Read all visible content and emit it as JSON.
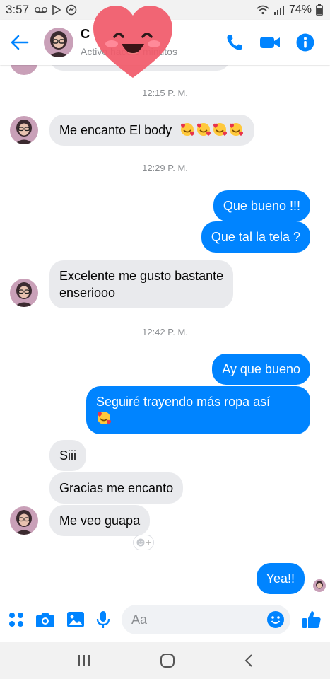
{
  "status_bar": {
    "time": "3:57",
    "battery": "74%"
  },
  "header": {
    "contact_name": "C",
    "active_status": "Activo hace 9 minutos"
  },
  "messages": [
    {
      "type": "time",
      "text": "12:15 P. M."
    },
    {
      "type": "in",
      "text": "Me encanto El body",
      "emoji_count": 4
    },
    {
      "type": "time",
      "text": "12:29 P. M."
    },
    {
      "type": "out",
      "text": "Que bueno !!!"
    },
    {
      "type": "out",
      "text": "Que tal la tela ?"
    },
    {
      "type": "in",
      "lines": [
        "Excelente me gusto bastante",
        "enseriooo"
      ]
    },
    {
      "type": "time",
      "text": "12:42 P. M."
    },
    {
      "type": "out",
      "text": "Ay que bueno"
    },
    {
      "type": "out",
      "text": "Seguiré trayendo más ropa así",
      "emoji_count": 1
    },
    {
      "type": "in",
      "text": "Siii"
    },
    {
      "type": "in",
      "text": "Gracias me encanto"
    },
    {
      "type": "in",
      "text": "Me veo guapa"
    },
    {
      "type": "out",
      "text": "Yea!!"
    }
  ],
  "composer": {
    "placeholder": "Aa"
  },
  "colors": {
    "accent": "#0084ff",
    "incoming_bubble": "#e9eaed",
    "timestamp": "#8a8d91"
  },
  "icons": {
    "header": [
      "back-arrow-icon",
      "phone-icon",
      "video-camera-icon",
      "info-icon"
    ],
    "composer": [
      "apps-grid-icon",
      "camera-icon",
      "gallery-icon",
      "microphone-icon",
      "emoji-icon",
      "like-icon"
    ],
    "navbar": [
      "recent-apps-icon",
      "home-icon",
      "back-icon"
    ]
  }
}
